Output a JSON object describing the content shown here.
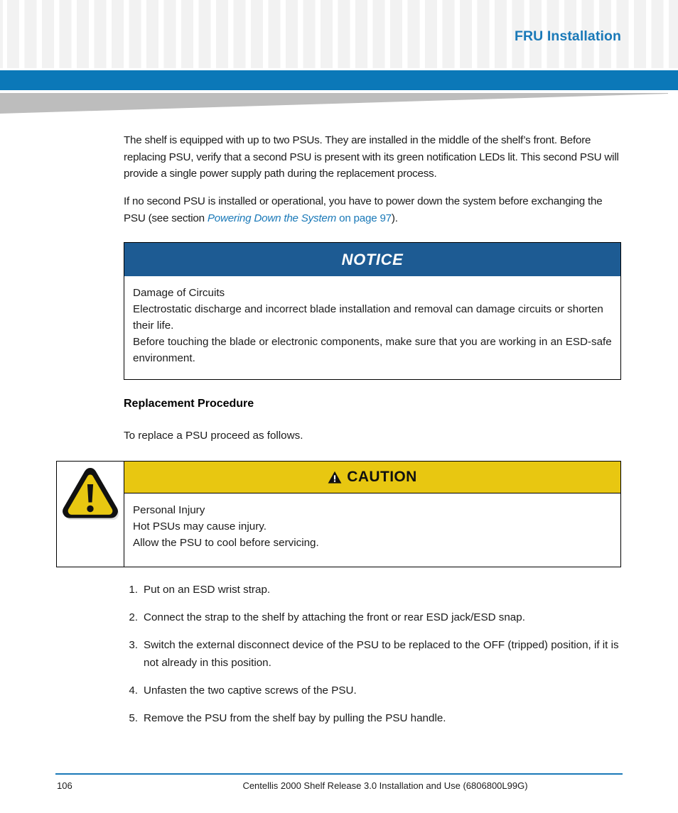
{
  "header": {
    "title": "FRU Installation",
    "accent_blue": "#0b78b8",
    "title_blue": "#1a79b8",
    "wedge_gray": "#bdbdbd"
  },
  "body": {
    "paragraph_1": "The shelf is equipped with up to two PSUs. They are installed in the middle of the shelf’s front. Before replacing PSU, verify that a second PSU is present with its green notification LEDs lit. This second PSU will provide a single power supply path during the replacement process.",
    "paragraph_2_pre": "If no second PSU is installed or operational, you have to power down the system before exchanging the PSU (see section ",
    "paragraph_2_link_italic": "Powering Down the System",
    "paragraph_2_link_plain": " on page 97",
    "paragraph_2_post": ")."
  },
  "notice": {
    "label": "NOTICE",
    "header_color": "#1d5b93",
    "line_1": "Damage of Circuits",
    "line_2": "Electrostatic discharge and incorrect blade installation and removal can damage circuits or shorten their life.",
    "line_3": "Before touching the blade or electronic components, make sure that you are working in an ESD-safe environment."
  },
  "section": {
    "heading": "Replacement Procedure",
    "intro": "To replace a PSU proceed as follows."
  },
  "caution": {
    "label": "CAUTION",
    "header_color": "#e8c711",
    "icon": "warning-triangle-icon",
    "line_1": "Personal Injury",
    "line_2": "Hot PSUs may cause injury.",
    "line_3": "Allow the PSU to cool before servicing."
  },
  "steps": [
    {
      "num": "1.",
      "text": "Put on an ESD wrist strap."
    },
    {
      "num": "2.",
      "text": "Connect the strap to the shelf by attaching the front or rear ESD jack/ESD snap."
    },
    {
      "num": "3.",
      "text": "Switch the external disconnect device of the PSU to be replaced to the OFF (tripped) position, if it is not already in this position."
    },
    {
      "num": "4.",
      "text": "Unfasten the two captive screws of the PSU."
    },
    {
      "num": "5.",
      "text": "Remove the PSU from the shelf bay by pulling the PSU handle."
    }
  ],
  "footer": {
    "page_number": "106",
    "document_title": "Centellis 2000 Shelf Release 3.0 Installation and Use (6806800L99G)",
    "rule_color": "#1a79b8"
  }
}
